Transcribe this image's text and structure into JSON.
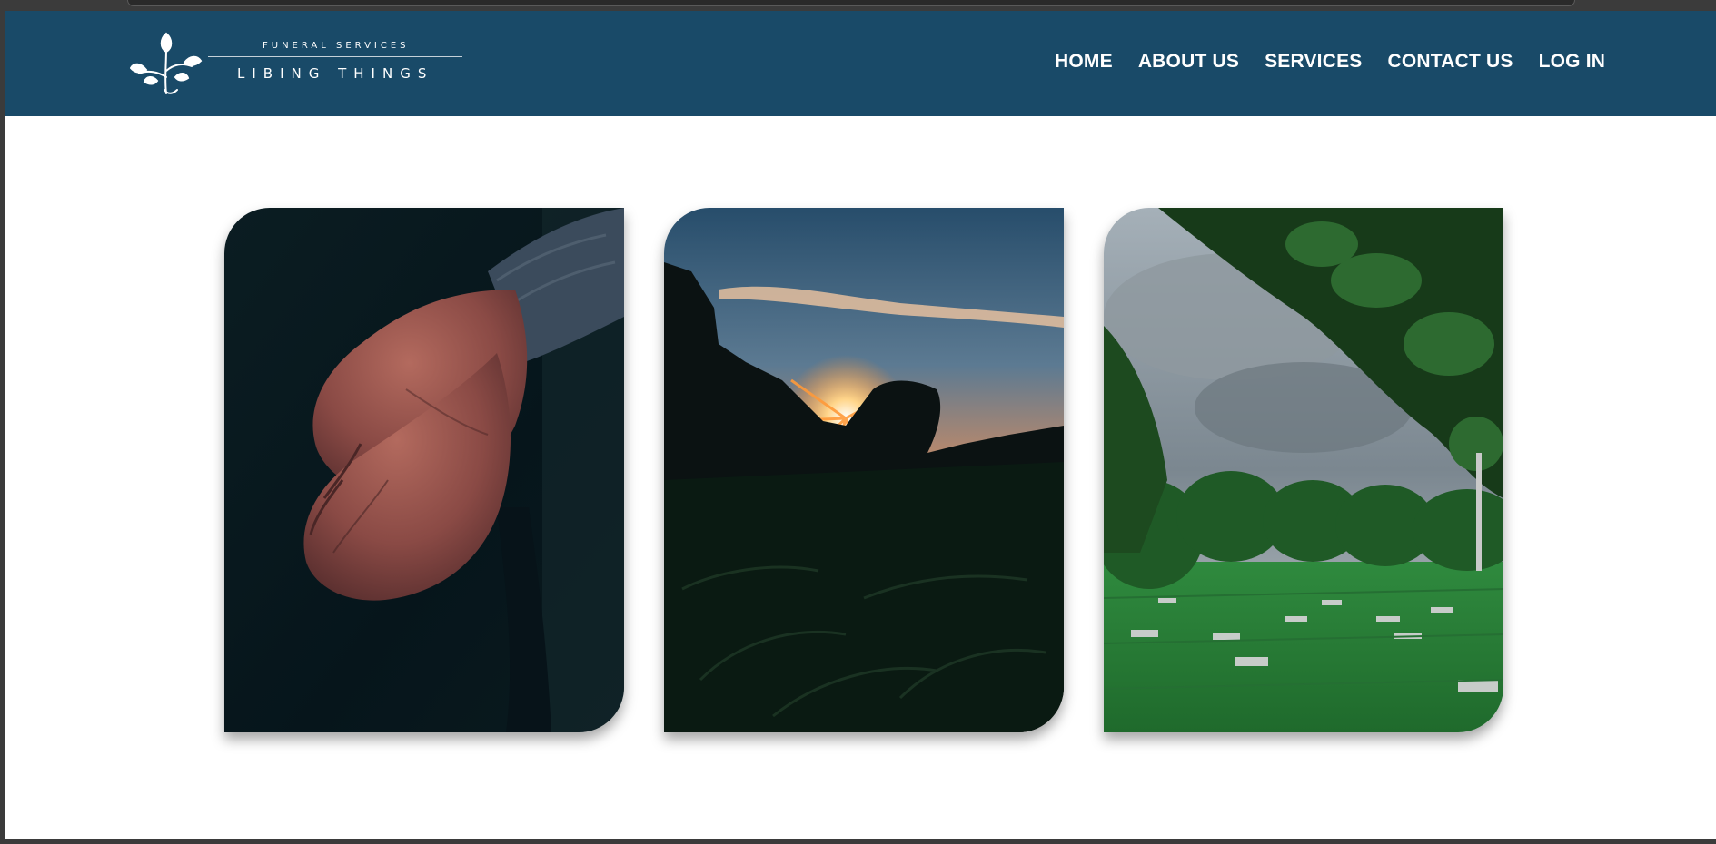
{
  "header": {
    "logo": {
      "tagline": "FUNERAL SERVICES",
      "name": "LIBING THINGS"
    },
    "nav": [
      {
        "label": "HOME"
      },
      {
        "label": "ABOUT US"
      },
      {
        "label": "SERVICES"
      },
      {
        "label": "CONTACT US"
      },
      {
        "label": "LOG IN"
      }
    ]
  },
  "gallery": {
    "images": [
      {
        "subject": "elderly clasped hands"
      },
      {
        "subject": "sunset over rocky ridge"
      },
      {
        "subject": "memorial park lawn under trees"
      }
    ]
  },
  "colors": {
    "navbar": "#194a68",
    "nav_text": "#ffffff",
    "page_bg": "#ffffff"
  }
}
